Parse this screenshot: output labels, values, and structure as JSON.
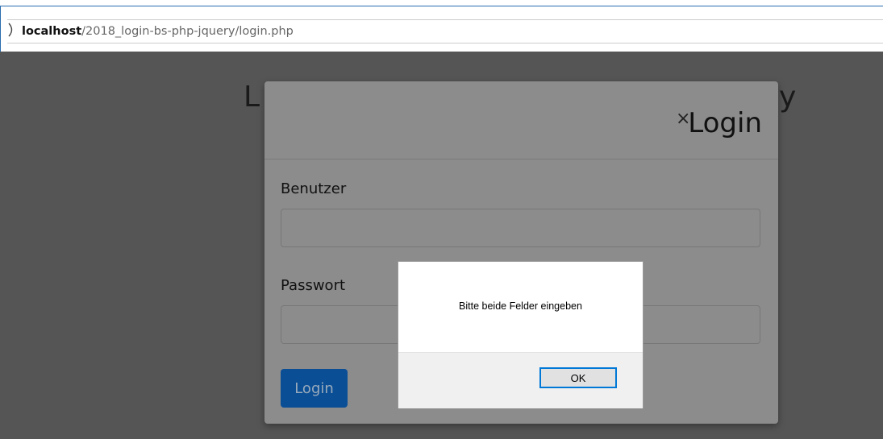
{
  "browser": {
    "url_host": "localhost",
    "url_path": "/2018_login-bs-php-jquery/login.php"
  },
  "page": {
    "heading_left_fragment": "L",
    "heading_right_fragment": "y"
  },
  "modal": {
    "title": "Login",
    "close_glyph": "×",
    "user_label": "Benutzer",
    "user_value": "",
    "password_label": "Passwort",
    "password_value": "",
    "login_button": "Login"
  },
  "alert": {
    "message": "Bitte beide Felder eingeben",
    "ok_button": "OK"
  },
  "colors": {
    "overlay": "#555555",
    "primary_button": "#0a4e96",
    "focus_border": "#0078d7"
  }
}
